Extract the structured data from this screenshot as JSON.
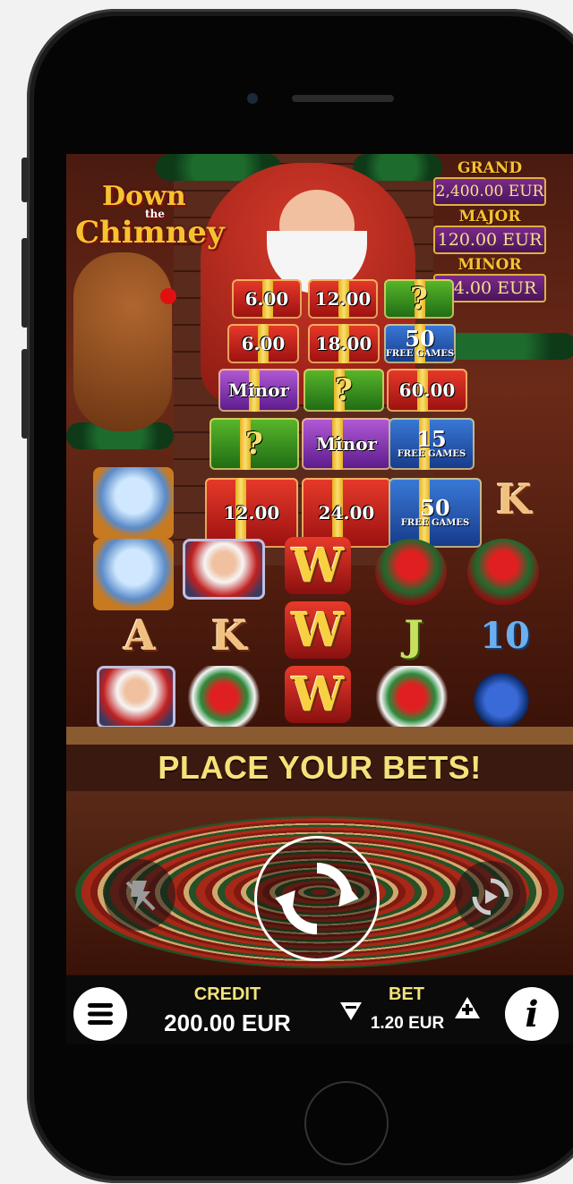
{
  "game": {
    "logo": {
      "line1": "Down",
      "line2": "the",
      "line3": "Chimney"
    }
  },
  "jackpots": [
    {
      "label": "GRAND",
      "value": "2,400.00 EUR"
    },
    {
      "label": "MAJOR",
      "value": "120.00 EUR"
    },
    {
      "label": "MINOR",
      "value": "24.00 EUR"
    }
  ],
  "reels": {
    "gifts": [
      {
        "text": "6.00",
        "color": "red"
      },
      {
        "text": "12.00",
        "color": "red"
      },
      {
        "text": "?",
        "color": "green"
      },
      {
        "text": "6.00",
        "color": "red"
      },
      {
        "text": "18.00",
        "color": "red"
      },
      {
        "text": "50",
        "sub": "FREE GAMES",
        "color": "blue"
      },
      {
        "text": "Minor",
        "color": "purple"
      },
      {
        "text": "?",
        "color": "green"
      },
      {
        "text": "60.00",
        "color": "red"
      },
      {
        "text": "?",
        "color": "green"
      },
      {
        "text": "Minor",
        "color": "purple"
      },
      {
        "text": "15",
        "sub": "FREE GAMES",
        "color": "blue"
      },
      {
        "text": "12.00",
        "color": "red"
      },
      {
        "text": "24.00",
        "color": "red"
      },
      {
        "text": "50",
        "sub": "FREE GAMES",
        "color": "blue"
      }
    ],
    "symbols": {
      "k1": "K",
      "a": "A",
      "k2": "K",
      "w1": "W",
      "w2": "W",
      "w3": "W",
      "j": "J",
      "ten": "10"
    }
  },
  "message": "PLACE YOUR BETS!",
  "controls": {
    "credit_label": "CREDIT",
    "credit_value": "200.00 EUR",
    "bet_label": "BET",
    "bet_value": "1.20 EUR",
    "info_glyph": "i"
  },
  "colors": {
    "accent_yellow": "#f4e27a",
    "jackpot_purple": "#7a2a8a",
    "gift_red": "#e83a2a"
  }
}
